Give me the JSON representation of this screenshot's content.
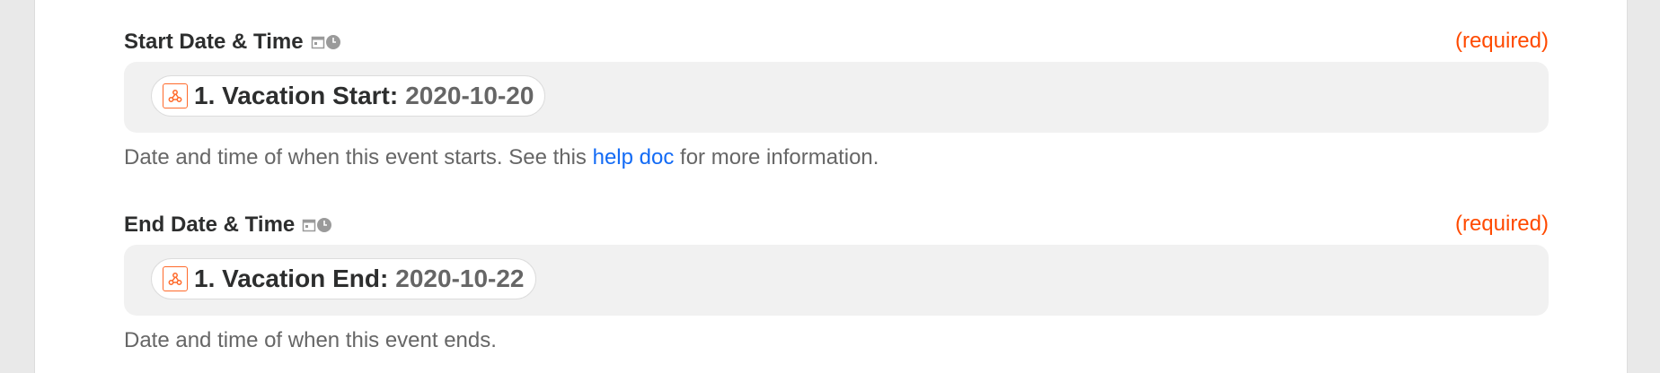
{
  "fields": {
    "start": {
      "label": "Start Date & Time",
      "required": "(required)",
      "pill_label": "1. Vacation Start:",
      "pill_value": "2020-10-20",
      "help_before": "Date and time of when this event starts. See this ",
      "help_link": "help doc",
      "help_after": " for more information."
    },
    "end": {
      "label": "End Date & Time",
      "required": "(required)",
      "pill_label": "1. Vacation End:",
      "pill_value": "2020-10-22",
      "help_before": "Date and time of when this event ends."
    }
  },
  "icons": {
    "type_icons": [
      "calendar-icon",
      "clock-icon"
    ],
    "app_badge": "webhook-icon"
  },
  "colors": {
    "required": "#ff4a00",
    "link": "#136bf5",
    "input_bg": "#f1f1f1",
    "app_accent": "#ff6a2b"
  }
}
